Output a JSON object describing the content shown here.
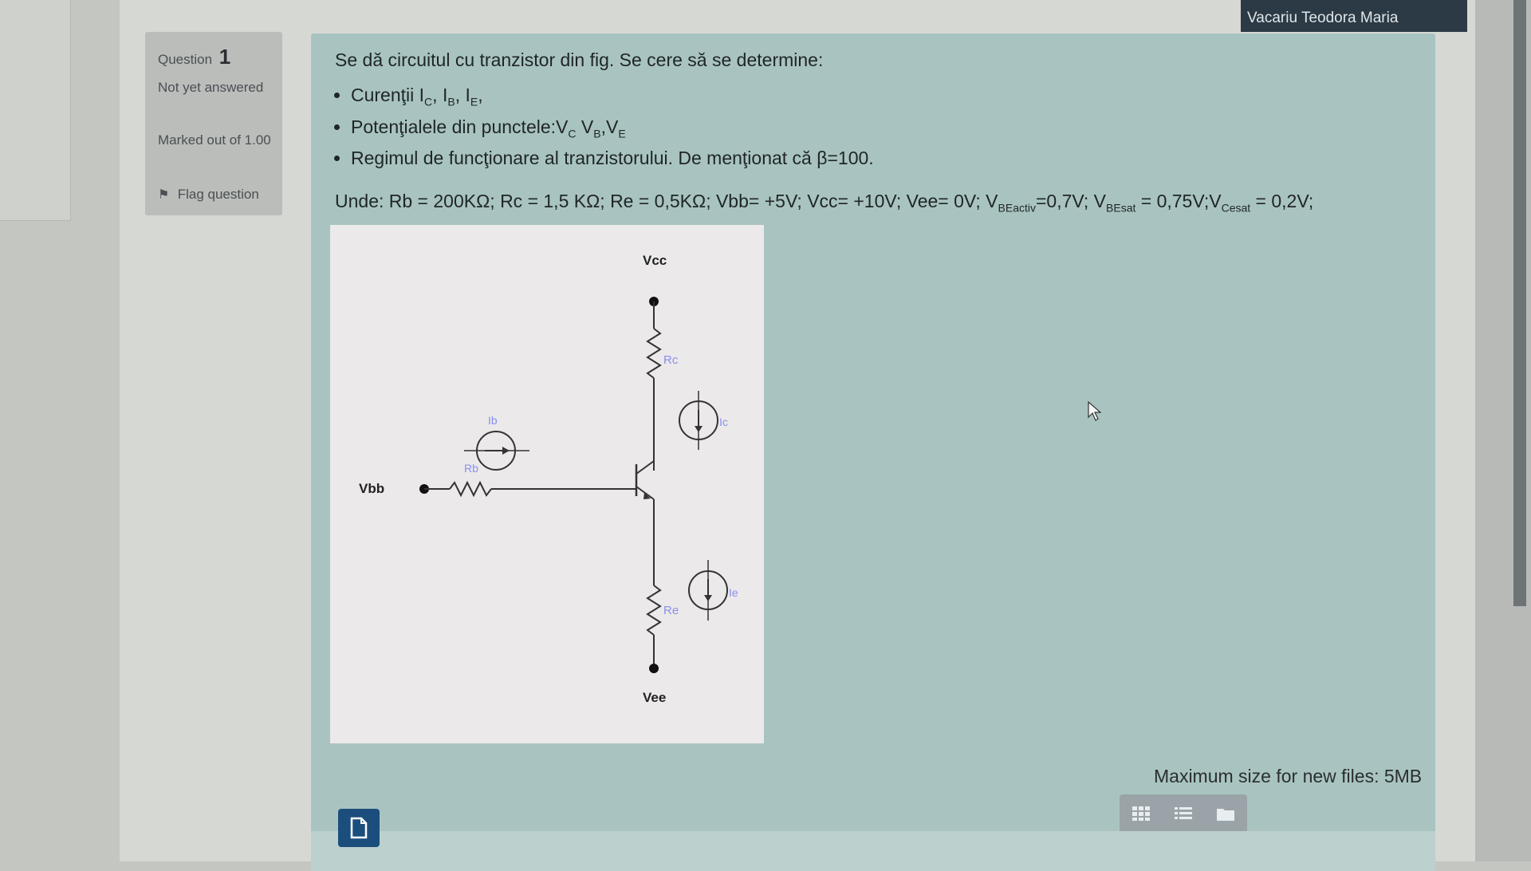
{
  "video_label": "Vacariu Teodora Maria",
  "question_info": {
    "title": "Question",
    "number": "1",
    "status": "Not yet answered",
    "marked": "Marked out of 1.00",
    "flag": "Flag question"
  },
  "question": {
    "intro": "Se dă circuitul cu tranzistor din fig.  Se cere să se determine:",
    "bullets": {
      "b1": {
        "text": "Curenţii I",
        "s1": "C",
        "m1": ", I",
        "s2": "B",
        "m2": ", I",
        "s3": "E",
        "end": ","
      },
      "b2": {
        "text": "Potenţialele din punctele:V",
        "s1": "C",
        "m1": " V",
        "s2": "B",
        "m2": ",V",
        "s3": "E"
      },
      "b3": "Regimul de funcţionare al tranzistorului. De menţionat că β=100."
    },
    "params": {
      "p1": "Unde: Rb = 200KΩ;  Rc = 1,5 KΩ;  Re = 0,5KΩ; Vbb= +5V;  Vcc= +10V;  Vee= 0V; V",
      "s1": "BEactiv",
      "p2": "=0,7V; V",
      "s2": "BEsat",
      "p3": " = 0,75V;V",
      "s3": "Cesat",
      "p4": " = 0,2V;"
    }
  },
  "circuit": {
    "vcc": "Vcc",
    "vee": "Vee",
    "vbb": "Vbb",
    "rc": "Rc",
    "re": "Re",
    "rb": "Rb",
    "ib": "Ib",
    "ic": "Ic",
    "ie": "Ie"
  },
  "file_manager": {
    "max_size": "Maximum size for new files: 5MB"
  },
  "colors": {
    "panel": "#a9c4c0",
    "add_button": "#1c4e7d",
    "label_blue": "#8a8ff0"
  }
}
